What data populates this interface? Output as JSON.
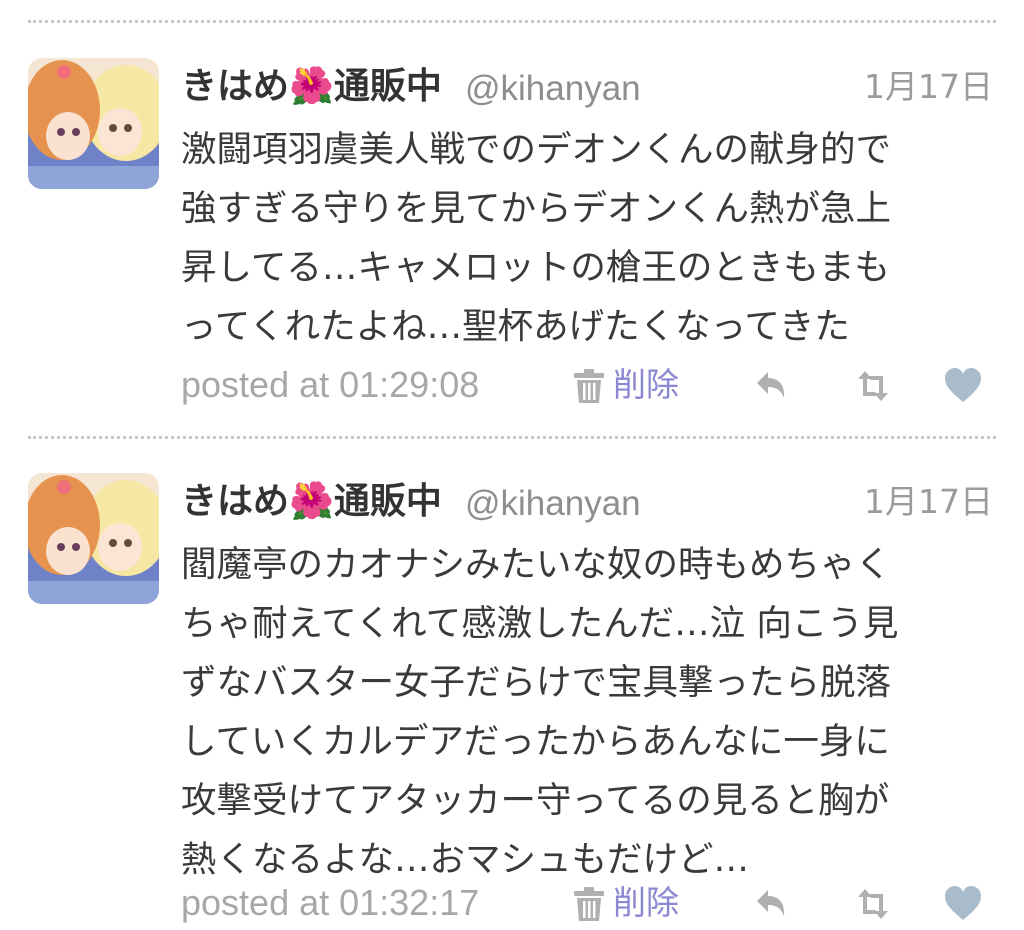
{
  "tweets": [
    {
      "display_name": "きはめ🌺通販中",
      "handle": "@kihanyan",
      "date": "1月17日",
      "body_lines": [
        "激闘項羽虞美人戦でのデオンくんの献身的で",
        "強すぎる守りを見てからデオンくん熱が急上",
        "昇してる…キャメロットの槍王のときもまも",
        "ってくれたよね…聖杯あげたくなってきた"
      ],
      "posted": "posted at 01:29:08",
      "delete_label": "削除"
    },
    {
      "display_name": "きはめ🌺通販中",
      "handle": "@kihanyan",
      "date": "1月17日",
      "body_lines": [
        "閻魔亭のカオナシみたいな奴の時もめちゃく",
        "ちゃ耐えてくれて感激したんだ…泣  向こう見",
        "ずなバスター女子だらけで宝具撃ったら脱落",
        "していくカルデアだったからあんなに一身に",
        "攻撃受けてアタッカー守ってるの見ると胸が",
        "熱くなるよな…おマシュもだけど…"
      ],
      "posted": "posted at 01:32:17",
      "delete_label": "削除"
    }
  ],
  "icons": {
    "trash": "trash-icon",
    "reply": "reply-icon",
    "retweet": "retweet-icon",
    "like": "heart-icon"
  },
  "colors": {
    "delete_label": "#8c87d2",
    "muted_text": "#a7a7a7",
    "icon_gray": "#b0b0b0",
    "heart": "#a9bccb"
  }
}
